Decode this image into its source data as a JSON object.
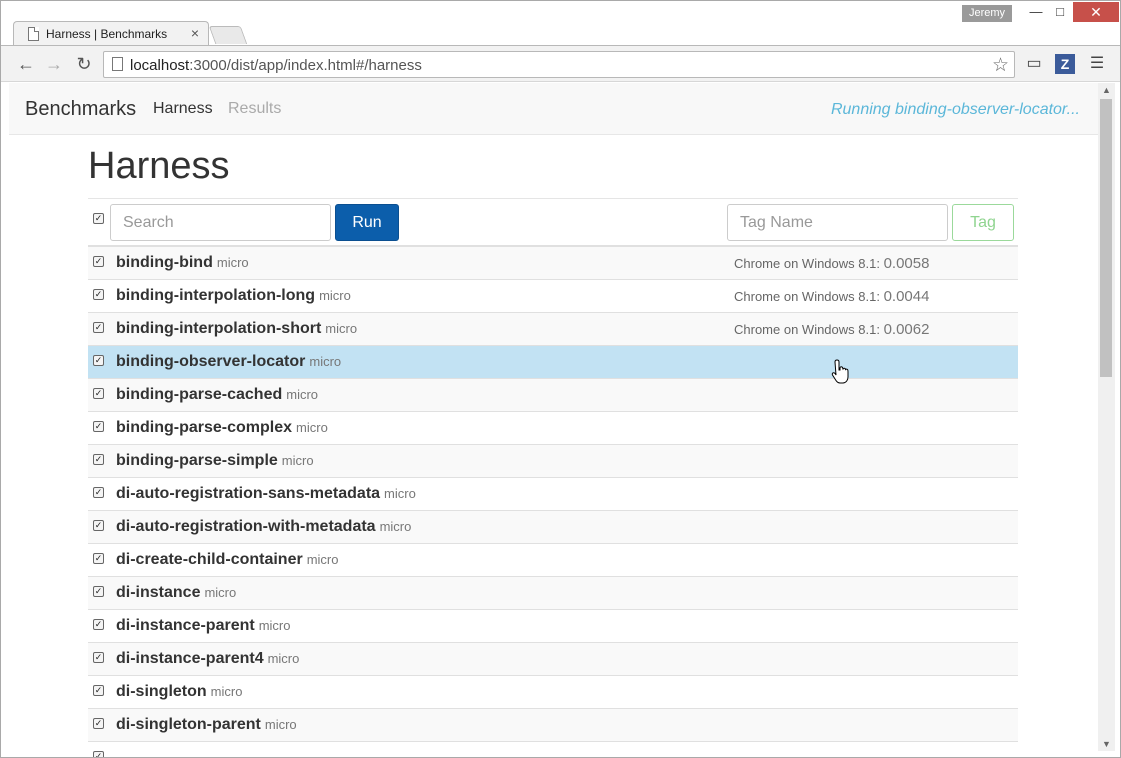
{
  "browser": {
    "tab_title": "Harness | Benchmarks",
    "tab_close": "×",
    "user": "Jeremy",
    "url_host": "localhost",
    "url_rest": ":3000/dist/app/index.html#/harness",
    "ext_letter": "Z"
  },
  "navbar": {
    "brand": "Benchmarks",
    "links": [
      "Harness",
      "Results"
    ],
    "status": "Running binding-observer-locator..."
  },
  "page": {
    "title": "Harness"
  },
  "controls": {
    "search_placeholder": "Search",
    "run_label": "Run",
    "tag_placeholder": "Tag Name",
    "tag_label": "Tag"
  },
  "benchmarks": [
    {
      "name": "binding-bind",
      "tag": "micro",
      "result_label": "Chrome on Windows 8.1:",
      "score": "0.0058",
      "checked": true
    },
    {
      "name": "binding-interpolation-long",
      "tag": "micro",
      "result_label": "Chrome on Windows 8.1:",
      "score": "0.0044",
      "checked": true
    },
    {
      "name": "binding-interpolation-short",
      "tag": "micro",
      "result_label": "Chrome on Windows 8.1:",
      "score": "0.0062",
      "checked": true
    },
    {
      "name": "binding-observer-locator",
      "tag": "micro",
      "result_label": "",
      "score": "",
      "checked": true,
      "active": true
    },
    {
      "name": "binding-parse-cached",
      "tag": "micro",
      "result_label": "",
      "score": "",
      "checked": true
    },
    {
      "name": "binding-parse-complex",
      "tag": "micro",
      "result_label": "",
      "score": "",
      "checked": true
    },
    {
      "name": "binding-parse-simple",
      "tag": "micro",
      "result_label": "",
      "score": "",
      "checked": true
    },
    {
      "name": "di-auto-registration-sans-metadata",
      "tag": "micro",
      "result_label": "",
      "score": "",
      "checked": true
    },
    {
      "name": "di-auto-registration-with-metadata",
      "tag": "micro",
      "result_label": "",
      "score": "",
      "checked": true
    },
    {
      "name": "di-create-child-container",
      "tag": "micro",
      "result_label": "",
      "score": "",
      "checked": true
    },
    {
      "name": "di-instance",
      "tag": "micro",
      "result_label": "",
      "score": "",
      "checked": true
    },
    {
      "name": "di-instance-parent",
      "tag": "micro",
      "result_label": "",
      "score": "",
      "checked": true
    },
    {
      "name": "di-instance-parent4",
      "tag": "micro",
      "result_label": "",
      "score": "",
      "checked": true
    },
    {
      "name": "di-singleton",
      "tag": "micro",
      "result_label": "",
      "score": "",
      "checked": true
    },
    {
      "name": "di-singleton-parent",
      "tag": "micro",
      "result_label": "",
      "score": "",
      "checked": true
    },
    {
      "name": "",
      "tag": "",
      "result_label": "",
      "score": "",
      "checked": true
    }
  ]
}
